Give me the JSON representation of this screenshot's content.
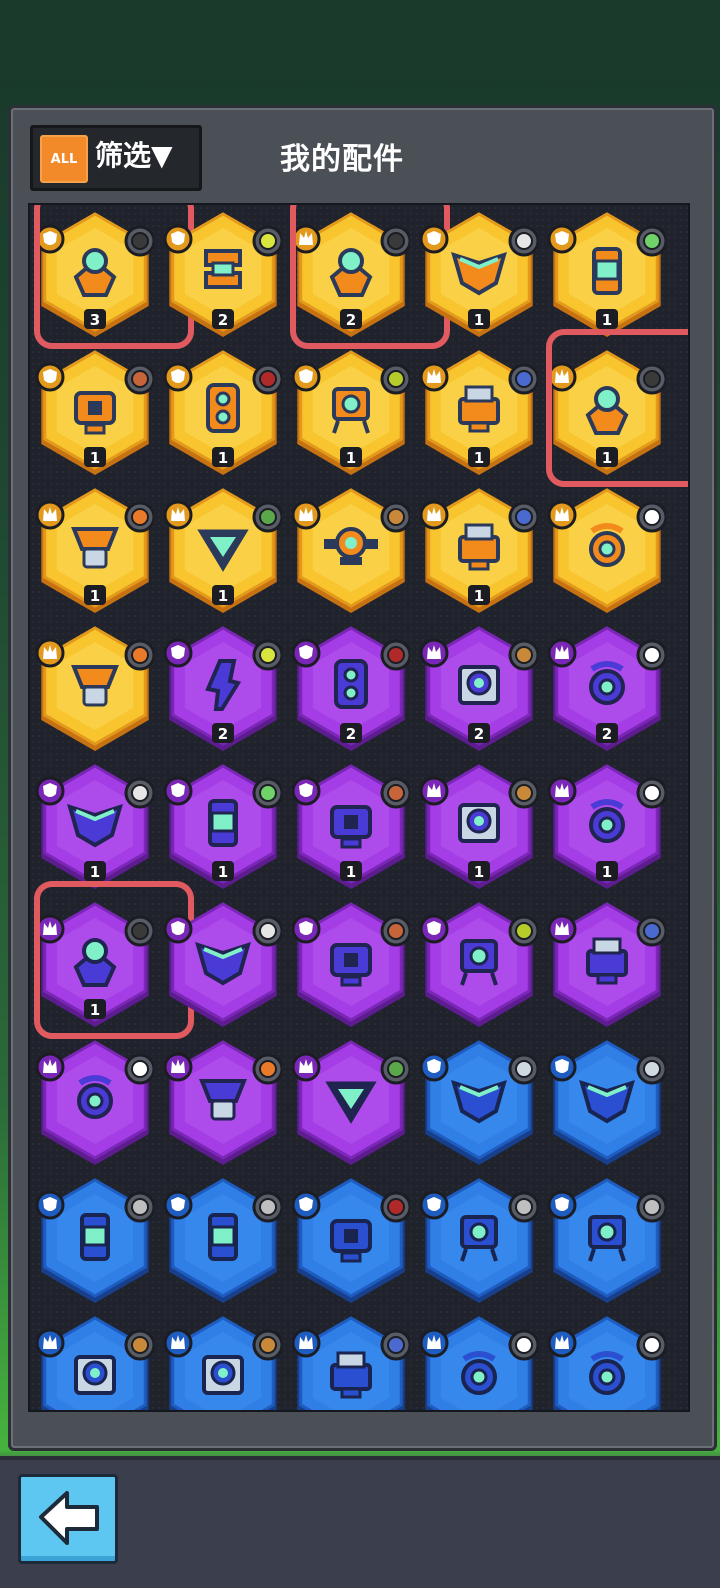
{
  "filter": {
    "all_label": "ALL",
    "label": "筛选▼"
  },
  "title": "我的配件",
  "colors": {
    "gold": "#f9c52e",
    "purple": "#a53de6",
    "blue": "#2f7fe6",
    "highlight": "#e05a60"
  },
  "rows": [
    [
      {
        "tier": "gold",
        "count": "3",
        "icon": "eye-pod-icon",
        "badge": "shield",
        "slot": "camera",
        "hl": true
      },
      {
        "tier": "gold",
        "count": "2",
        "icon": "coupler-icon",
        "badge": "shield",
        "slot": "wheel"
      },
      {
        "tier": "gold",
        "count": "2",
        "icon": "eye-pod-icon",
        "badge": "crown",
        "slot": "camera",
        "hl": true
      },
      {
        "tier": "gold",
        "count": "1",
        "icon": "wing-icon",
        "badge": "shield",
        "slot": "rocket"
      },
      {
        "tier": "gold",
        "count": "1",
        "icon": "canister-icon",
        "badge": "shield",
        "slot": "gift"
      }
    ],
    [
      {
        "tier": "gold",
        "count": "1",
        "icon": "core-box-icon",
        "badge": "shield",
        "slot": "brick"
      },
      {
        "tier": "gold",
        "count": "1",
        "icon": "double-lens-icon",
        "badge": "shield",
        "slot": "arc"
      },
      {
        "tier": "gold",
        "count": "1",
        "icon": "walker-icon",
        "badge": "shield",
        "slot": "sun"
      },
      {
        "tier": "gold",
        "count": "1",
        "icon": "printer-icon",
        "badge": "crown",
        "slot": "drill"
      },
      {
        "tier": "gold",
        "count": "1",
        "icon": "eye-pod-icon",
        "badge": "crown",
        "slot": "camera",
        "hl": true
      }
    ],
    [
      {
        "tier": "gold",
        "count": "1",
        "icon": "hopper-icon",
        "badge": "crown",
        "slot": "box"
      },
      {
        "tier": "gold",
        "count": "1",
        "icon": "tri-lens-icon",
        "badge": "crown",
        "slot": "bottle"
      },
      {
        "tier": "gold",
        "count": "",
        "icon": "turret-icon",
        "badge": "crown",
        "slot": "horn"
      },
      {
        "tier": "gold",
        "count": "1",
        "icon": "printer-icon",
        "badge": "crown",
        "slot": "drill"
      },
      {
        "tier": "gold",
        "count": "",
        "icon": "ring-lens-icon",
        "badge": "crown",
        "slot": "ball"
      }
    ],
    [
      {
        "tier": "gold",
        "count": "",
        "icon": "hopper-icon",
        "badge": "crown",
        "slot": "box"
      },
      {
        "tier": "purple",
        "count": "2",
        "icon": "bolt-icon",
        "badge": "shield",
        "slot": "wheel"
      },
      {
        "tier": "purple",
        "count": "2",
        "icon": "double-lens-icon",
        "badge": "shield",
        "slot": "arc"
      },
      {
        "tier": "purple",
        "count": "2",
        "icon": "scope-icon",
        "badge": "crown",
        "slot": "horn"
      },
      {
        "tier": "purple",
        "count": "2",
        "icon": "ring-lens-icon",
        "badge": "crown",
        "slot": "ball"
      }
    ],
    [
      {
        "tier": "purple",
        "count": "1",
        "icon": "wing-icon",
        "badge": "shield",
        "slot": "rocket"
      },
      {
        "tier": "purple",
        "count": "1",
        "icon": "canister-icon",
        "badge": "shield",
        "slot": "gift"
      },
      {
        "tier": "purple",
        "count": "1",
        "icon": "core-box-icon",
        "badge": "shield",
        "slot": "brick"
      },
      {
        "tier": "purple",
        "count": "1",
        "icon": "scope-icon",
        "badge": "crown",
        "slot": "horn"
      },
      {
        "tier": "purple",
        "count": "1",
        "icon": "ring-lens-icon",
        "badge": "crown",
        "slot": "ball"
      }
    ],
    [
      {
        "tier": "purple",
        "count": "1",
        "icon": "eye-pod-icon",
        "badge": "crown",
        "slot": "camera",
        "hl": true
      },
      {
        "tier": "purple",
        "count": "",
        "icon": "wing-icon",
        "badge": "shield",
        "slot": "rocket"
      },
      {
        "tier": "purple",
        "count": "",
        "icon": "core-box-icon",
        "badge": "shield",
        "slot": "brick"
      },
      {
        "tier": "purple",
        "count": "",
        "icon": "walker-icon",
        "badge": "shield",
        "slot": "sun"
      },
      {
        "tier": "purple",
        "count": "",
        "icon": "printer-icon",
        "badge": "crown",
        "slot": "drill"
      }
    ],
    [
      {
        "tier": "purple",
        "count": "",
        "icon": "ring-lens-icon",
        "badge": "crown",
        "slot": "ball"
      },
      {
        "tier": "purple",
        "count": "",
        "icon": "hopper-icon",
        "badge": "crown",
        "slot": "box"
      },
      {
        "tier": "purple",
        "count": "",
        "icon": "tri-lens-icon",
        "badge": "crown",
        "slot": "bottle"
      },
      {
        "tier": "blue",
        "count": "",
        "icon": "wing-icon",
        "badge": "shield",
        "slot": "blade"
      },
      {
        "tier": "blue",
        "count": "",
        "icon": "wing-icon",
        "badge": "shield",
        "slot": "blade"
      }
    ],
    [
      {
        "tier": "blue",
        "count": "",
        "icon": "canister-icon",
        "badge": "shield",
        "slot": "rock"
      },
      {
        "tier": "blue",
        "count": "",
        "icon": "canister-icon",
        "badge": "shield",
        "slot": "rock"
      },
      {
        "tier": "blue",
        "count": "",
        "icon": "core-box-icon",
        "badge": "shield",
        "slot": "arc"
      },
      {
        "tier": "blue",
        "count": "",
        "icon": "walker-icon",
        "badge": "shield",
        "slot": "rock"
      },
      {
        "tier": "blue",
        "count": "",
        "icon": "walker-icon",
        "badge": "shield",
        "slot": "rock"
      }
    ],
    [
      {
        "tier": "blue",
        "count": "",
        "icon": "scope-icon",
        "badge": "crown",
        "slot": "horn"
      },
      {
        "tier": "blue",
        "count": "",
        "icon": "scope-icon",
        "badge": "crown",
        "slot": "horn"
      },
      {
        "tier": "blue",
        "count": "",
        "icon": "printer-icon",
        "badge": "crown",
        "slot": "drill"
      },
      {
        "tier": "blue",
        "count": "",
        "icon": "ring-lens-icon",
        "badge": "crown",
        "slot": "ball"
      },
      {
        "tier": "blue",
        "count": "",
        "icon": "ring-lens-icon",
        "badge": "crown",
        "slot": "ball"
      }
    ]
  ]
}
